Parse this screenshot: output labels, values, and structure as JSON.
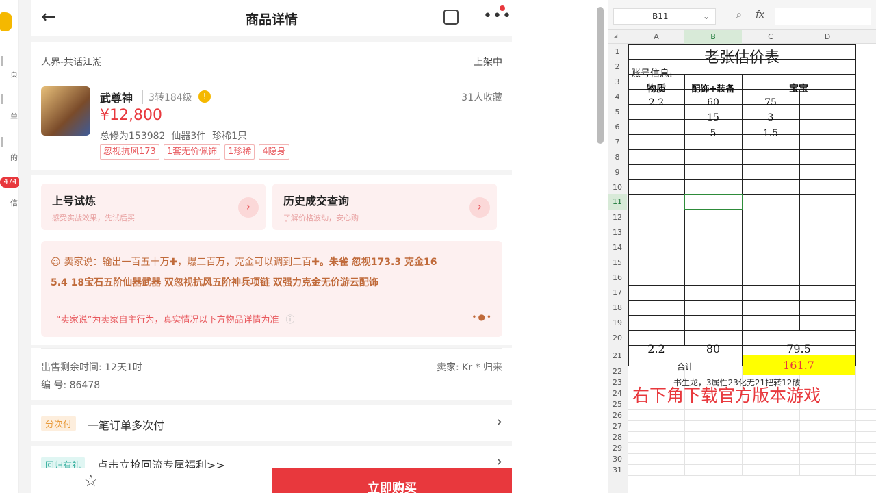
{
  "leftbar": {
    "items": [
      "页",
      "单",
      "的",
      "信"
    ],
    "badge": "474"
  },
  "nav": {
    "title": "商品详情"
  },
  "product": {
    "server": "人界-共话江湖",
    "status": "上架中",
    "name": "武尊神",
    "level": "3转184级",
    "favorites": "31人收藏",
    "price": "¥12,800",
    "stats": "总修为153982  仙器3件  珍稀1只",
    "tags": [
      "忽视抗风173",
      "1套无价佩饰",
      "1珍稀",
      "4隐身"
    ]
  },
  "cards": [
    {
      "title": "上号试炼",
      "subtitle": "感受实战效果，先试后买"
    },
    {
      "title": "历史成交查询",
      "subtitle": "了解价格波动，安心购"
    }
  ],
  "seller": {
    "intro": "卖家说：输出一百五十万",
    "text1": "，爆二百万，克金可以调到二百",
    "text2": "。朱雀 忽视173.3 克金16",
    "text3": "5.4 18宝石五阶仙器武器 双忽视抗风五阶神兵项链 双强力克金无价游云配饰",
    "disclaimer": "“卖家说”为卖家自主行为，真实情况以下方物品详情为准"
  },
  "sale": {
    "remaining": "出售剩余时间: 12天1时",
    "seller": "卖家: Kr * 归来",
    "id": "编 号: 86478"
  },
  "installment": {
    "badge": "分次付",
    "text": "一笔订单多次付"
  },
  "promo": {
    "badge": "回归有礼",
    "text": "点击立抢回流专属福利>>"
  },
  "bottom": {
    "buy": "立即购买"
  },
  "sheet": {
    "namebox": "B11",
    "fx": "fx",
    "cols": [
      "A",
      "B",
      "C",
      "D"
    ],
    "rows": [
      "1",
      "2",
      "3",
      "4",
      "5",
      "6",
      "7",
      "8",
      "9",
      "10",
      "11",
      "12",
      "13",
      "14",
      "15",
      "16",
      "17",
      "18",
      "19",
      "20",
      "21",
      "22",
      "23",
      "24",
      "25",
      "26",
      "27",
      "28",
      "29",
      "30",
      "31"
    ],
    "title": "老张估价表",
    "account": "账号信息:",
    "headers": [
      "物质",
      "配饰+装备",
      "宝宝"
    ],
    "data": [
      [
        "2.2",
        "60",
        "75"
      ],
      [
        "",
        "15",
        "3"
      ],
      [
        "",
        "5",
        "1.5"
      ]
    ],
    "totals": [
      "2.2",
      "80",
      "79.5"
    ],
    "sum_label": "合计",
    "sum_value": "161.7",
    "note": "书生龙，3属性23化无21把转12破",
    "overlay": "右下角下载官方版本游戏"
  },
  "colors": {
    "accent": "#e8383d",
    "highlight": "#ffff00",
    "sum_text": "#e8383d"
  }
}
